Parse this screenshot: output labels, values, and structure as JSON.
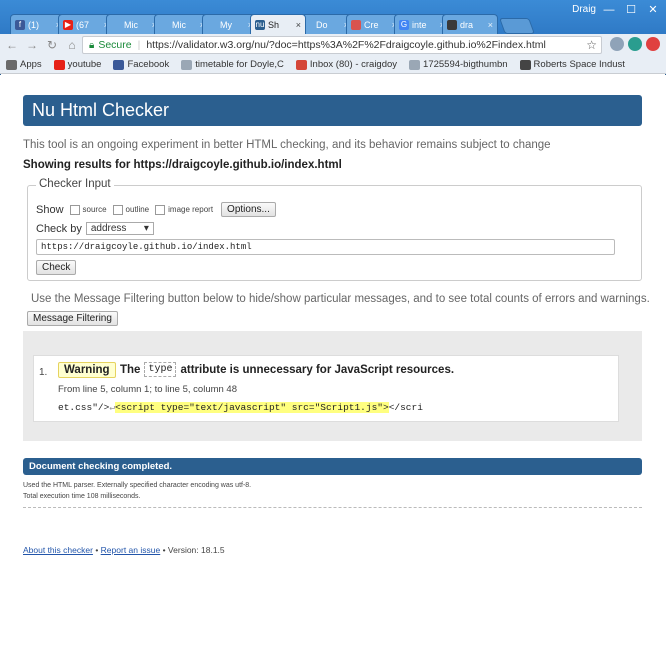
{
  "browser": {
    "tabs": [
      {
        "title": "(1)",
        "fav": "f",
        "fav_color": "#3b5998"
      },
      {
        "title": "(67",
        "fav": "▶",
        "fav_color": "#e62117"
      },
      {
        "title": "Mic",
        "fav": "",
        "fav_color": "#6aa8e0"
      },
      {
        "title": "Mic",
        "fav": "",
        "fav_color": "#6aa8e0"
      },
      {
        "title": "My",
        "fav": "",
        "fav_color": "#6aa8e0"
      },
      {
        "title": "Sh",
        "fav": "nu",
        "fav_color": "#2b5f8f",
        "active": true
      },
      {
        "title": "Do",
        "fav": "",
        "fav_color": "#6aa8e0"
      },
      {
        "title": "Cre",
        "fav": "",
        "fav_color": "#d9534f"
      },
      {
        "title": "inte",
        "fav": "G",
        "fav_color": "#4285f4"
      },
      {
        "title": "dra",
        "fav": "",
        "fav_color": "#3a3a3a"
      }
    ],
    "user": "Draig",
    "window_controls": {
      "minimize": "—",
      "maximize": "☐",
      "close": "✕"
    },
    "secure_label": "Secure",
    "url": "https://validator.w3.org/nu/?doc=https%3A%2F%2Fdraigcoyle.github.io%2Findex.html",
    "bookmarks": [
      {
        "label": "Apps",
        "color": "#6a6a6a"
      },
      {
        "label": "youtube",
        "color": "#e62117"
      },
      {
        "label": "Facebook",
        "color": "#3b5998"
      },
      {
        "label": "timetable for Doyle,C",
        "color": "#9aa7b5"
      },
      {
        "label": "Inbox (80) - craigdoy",
        "color": "#d44638"
      },
      {
        "label": "1725594-bigthumbn",
        "color": "#9aa7b5"
      },
      {
        "label": "Roberts Space Indust",
        "color": "#444444"
      }
    ]
  },
  "page": {
    "title": "Nu Html Checker",
    "intro": "This tool is an ongoing experiment in better HTML checking, and its behavior remains subject to change",
    "results_for": "Showing results for https://draigcoyle.github.io/index.html",
    "checker_input": {
      "legend": "Checker Input",
      "show_label": "Show",
      "options": [
        "source",
        "outline",
        "image report"
      ],
      "options_button": "Options...",
      "check_by_label": "Check by",
      "check_by_value": "address",
      "address_value": "https://draigcoyle.github.io/index.html",
      "check_button": "Check"
    },
    "filter_text": "Use the Message Filtering button below to hide/show particular messages, and to see total counts of errors and warnings.",
    "filter_button": "Message Filtering",
    "message": {
      "number": "1.",
      "type": "Warning",
      "text_before": "The",
      "code": "type",
      "text_after": "attribute is unnecessary for JavaScript resources.",
      "location": "From line 5, column 1; to line 5, column 48",
      "extract_before": "et.css\"/>",
      "extract_lf": "↵",
      "extract_mark": "<script type=\"text/javascript\" src=\"Script1.js\">",
      "extract_after": "</scri"
    },
    "done": "Document checking completed.",
    "details": [
      "Used the HTML parser. Externally specified character encoding was utf-8.",
      "Total execution time 108 milliseconds."
    ],
    "footer": {
      "about": "About this checker",
      "bullet": "•",
      "report": "Report an issue",
      "version": "• Version: 18.1.5"
    }
  }
}
